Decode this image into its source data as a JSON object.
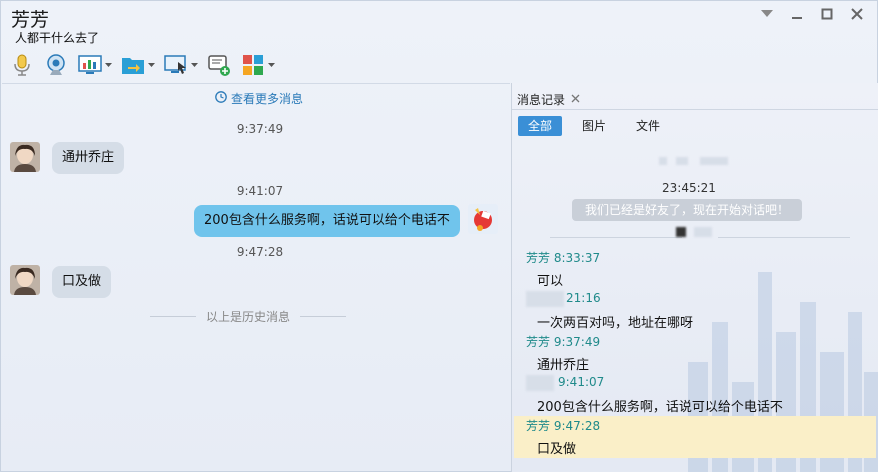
{
  "window": {
    "title": "芳芳",
    "status": "人都干什么去了",
    "controls": [
      "dropdown-icon",
      "minimize-icon",
      "maximize-icon",
      "close-icon"
    ]
  },
  "toolbar": {
    "items": [
      {
        "name": "voice-call",
        "icon": "microphone-icon",
        "has_dropdown": false
      },
      {
        "name": "video-call",
        "icon": "webcam-icon",
        "has_dropdown": false
      },
      {
        "name": "app",
        "icon": "monitor-chart-icon",
        "has_dropdown": true
      },
      {
        "name": "send-file",
        "icon": "folder-arrow-icon",
        "has_dropdown": true
      },
      {
        "name": "remote-desktop",
        "icon": "remote-monitor-icon",
        "has_dropdown": true
      },
      {
        "name": "send-sms",
        "icon": "message-add-icon",
        "has_dropdown": false
      },
      {
        "name": "apps",
        "icon": "apps-grid-icon",
        "has_dropdown": true
      }
    ]
  },
  "chat": {
    "view_more": "查看更多消息",
    "messages": [
      {
        "time": "9:37:49",
        "direction": "incoming",
        "text": "通卅乔庄"
      },
      {
        "time": "9:41:07",
        "direction": "outgoing",
        "text": "200包含什么服务啊，话说可以给个电话不"
      },
      {
        "time": "9:47:28",
        "direction": "incoming",
        "text": "口及做"
      }
    ],
    "history_divider": "以上是历史消息"
  },
  "history": {
    "tab_label": "消息记录",
    "filters": [
      "全部",
      "图片",
      "文件"
    ],
    "active_filter": "全部",
    "system_time": "23:45:21",
    "system_notice": "我们已经是好友了，现在开始对话吧！",
    "records": [
      {
        "sender": "芳芳",
        "time": "8:33:37",
        "text": "可以"
      },
      {
        "sender": "",
        "time": "21:16",
        "text": "一次两百对吗，地址在哪呀"
      },
      {
        "sender": "芳芳",
        "time": "9:37:49",
        "text": "通卅乔庄"
      },
      {
        "sender": "",
        "time": "9:41:07",
        "text": "200包含什么服务啊，话说可以给个电话不"
      },
      {
        "sender": "芳芳",
        "time": "9:47:28",
        "text": "口及做"
      }
    ]
  },
  "colors": {
    "accent": "#3a8fd6",
    "outgoing_bubble": "#70c4ec",
    "incoming_bubble": "#d5dde7",
    "sender_name": "#1f8a8a",
    "highlight": "#faefc8"
  }
}
